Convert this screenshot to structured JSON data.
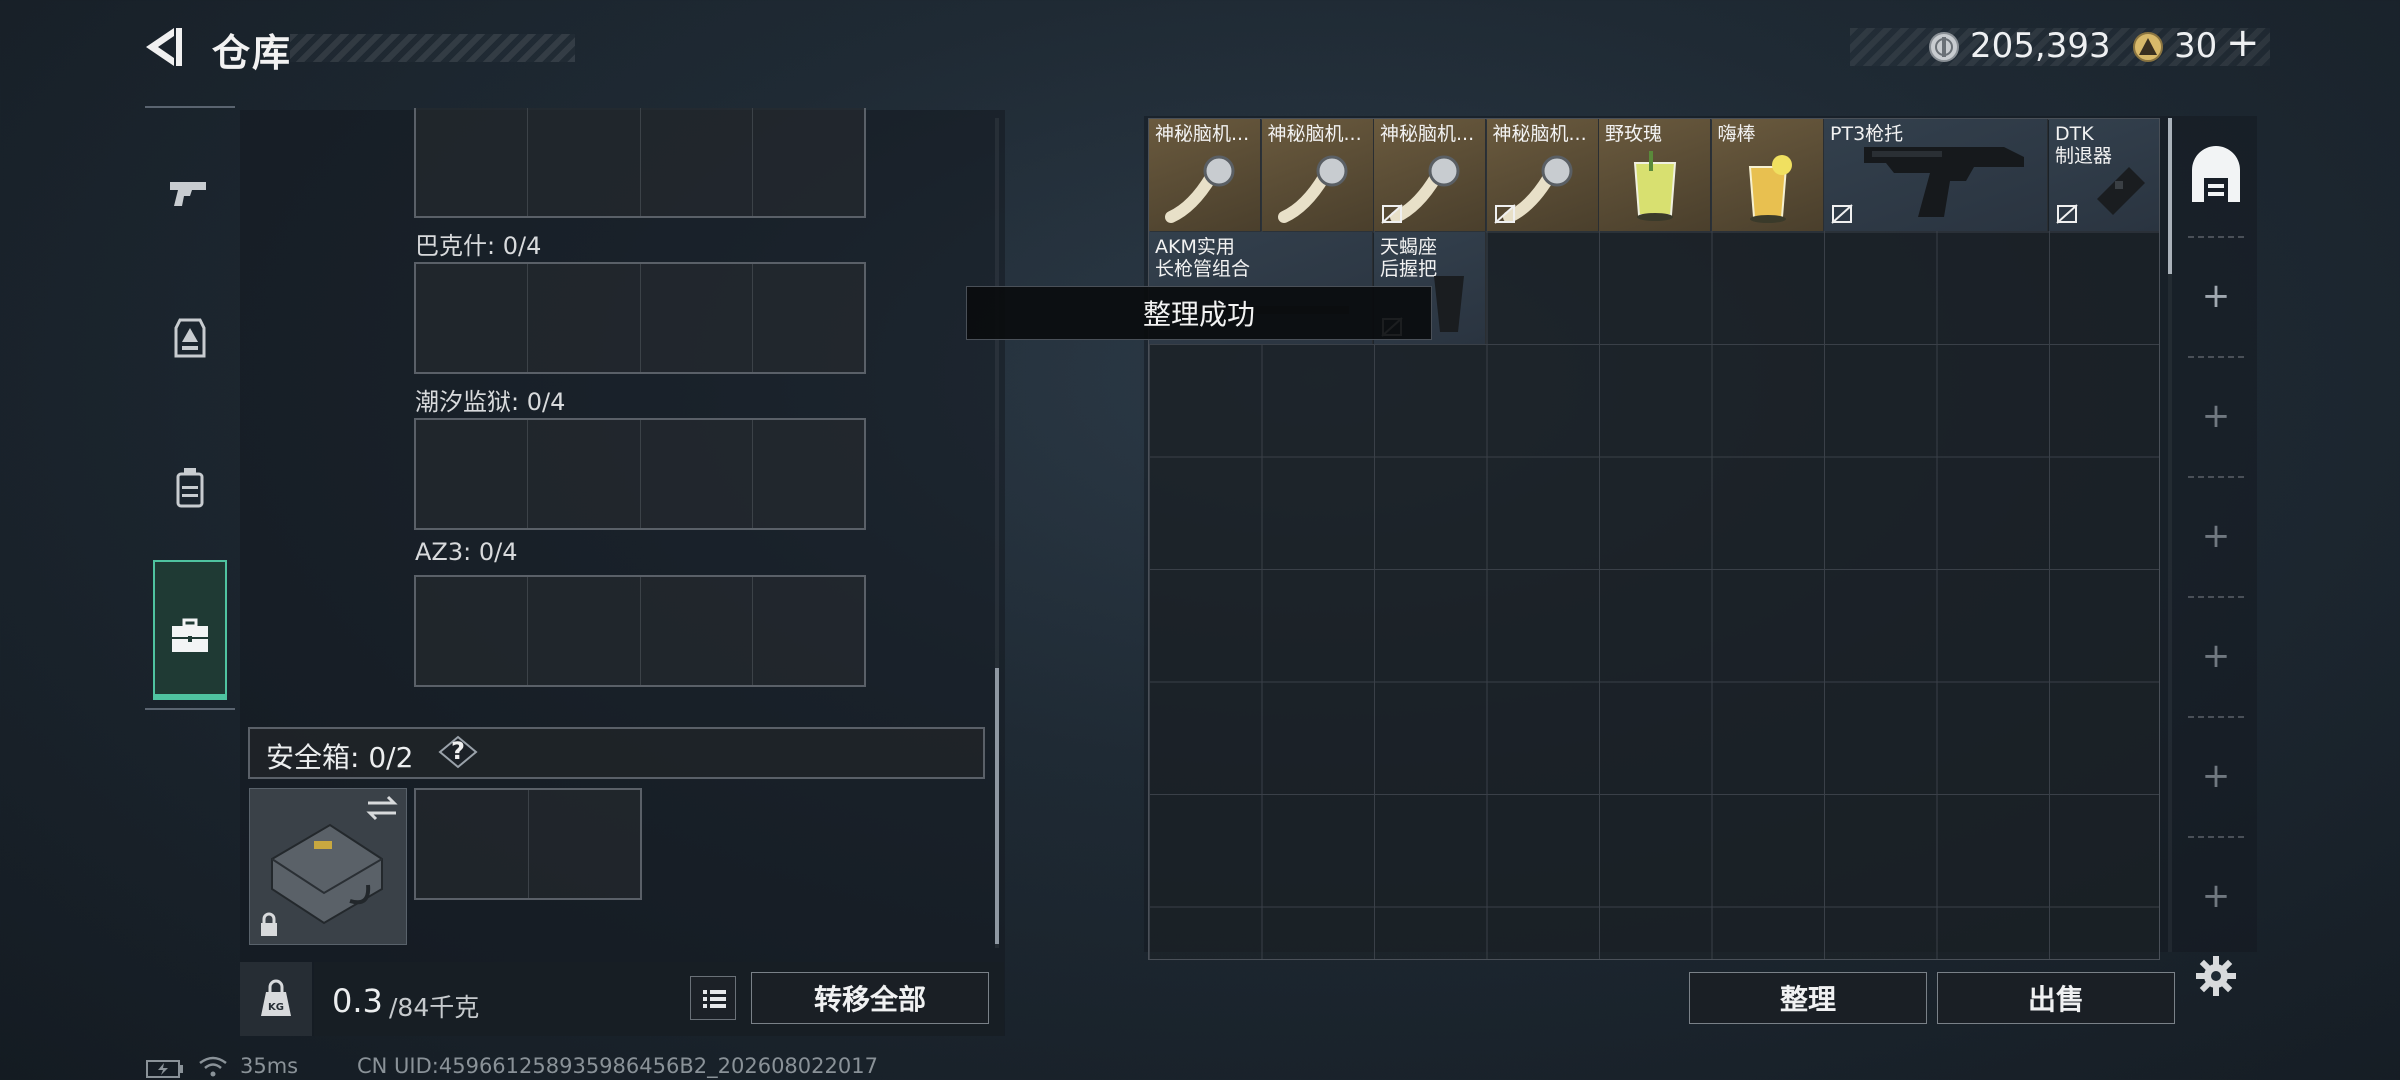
{
  "header": {
    "title": "仓库",
    "coins": "205,393",
    "tickets": "30",
    "tickets_plus": "+"
  },
  "left": {
    "containers": [
      {
        "label": ""
      },
      {
        "label": "巴克什: 0/4"
      },
      {
        "label": "潮汐监狱: 0/4"
      },
      {
        "label": "AZ3: 0/4"
      }
    ],
    "safe_box": {
      "label": "安全箱:  0/2",
      "help": "?"
    },
    "weight": {
      "current": "0.3",
      "max": "/84千克"
    },
    "transfer_all": "转移全部"
  },
  "grid": {
    "items": [
      {
        "name": "神秘脑机...",
        "tier": "gold"
      },
      {
        "name": "神秘脑机...",
        "tier": "gold"
      },
      {
        "name": "神秘脑机...",
        "tier": "gold"
      },
      {
        "name": "神秘脑机...",
        "tier": "gold"
      },
      {
        "name": "野玫瑰",
        "tier": "gold"
      },
      {
        "name": "嗨棒",
        "tier": "gold"
      },
      {
        "name": "PT3枪托",
        "tier": "blue"
      },
      {
        "name": "DTK\n制退器",
        "tier": "blue"
      },
      {
        "name": "AKM实用\n长枪管组合",
        "tier": "blue"
      },
      {
        "name": "天蝎座\n后握把",
        "tier": "blue"
      }
    ]
  },
  "toast": "整理成功",
  "buttons": {
    "sort": "整理",
    "sell": "出售"
  },
  "pages": {
    "add": "+"
  },
  "status": {
    "ping": "35ms",
    "uid": "CN UID:459661258935986456B2_202608022017"
  },
  "colors": {
    "accent": "#4fc3a0",
    "gold_item": "#6a5a3e",
    "blue_item": "#33404d"
  }
}
